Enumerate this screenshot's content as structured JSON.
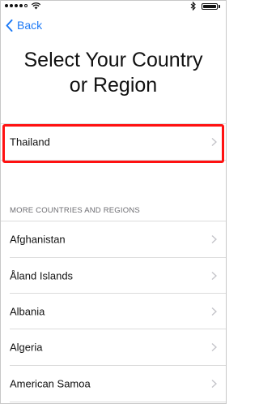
{
  "status_bar": {
    "signal_icon": "signal-dots-icon",
    "wifi_icon": "wifi-icon",
    "bluetooth_icon": "bluetooth-icon",
    "battery_icon": "battery-icon",
    "battery_level": 1.0
  },
  "nav": {
    "back_label": "Back",
    "back_icon": "chevron-left-icon"
  },
  "title": {
    "line1": "Select Your Country",
    "line2": "or Region"
  },
  "suggested": {
    "label": "Thailand",
    "highlight_color": "#ff1111"
  },
  "more_section": {
    "header": "MORE COUNTRIES AND REGIONS",
    "items": [
      "Afghanistan",
      "Åland Islands",
      "Albania",
      "Algeria",
      "American Samoa"
    ]
  },
  "colors": {
    "accent": "#1f7bf6",
    "separator": "#dcdcdc",
    "chevron": "#c4c4c9"
  }
}
